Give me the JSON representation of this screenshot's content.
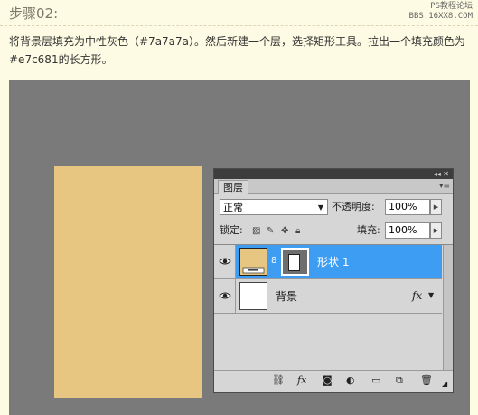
{
  "page": {
    "step_title": "步骤02:",
    "watermark_line1": "PS教程论坛",
    "watermark_line2": "BBS.16XX8.COM",
    "description": "将背景层填充为中性灰色（#7a7a7a）。然后新建一个层，选择矩形工具。拉出一个填充颜色为#e7c681的长方形。"
  },
  "colors": {
    "background_fill": "#7a7a7a",
    "rectangle_fill": "#e7c681",
    "selected_layer": "#3d9df3"
  },
  "layers_panel": {
    "titlebar_controls": "◂◂ ✕",
    "tab_label": "图层",
    "menu_icon": "panel-menu-icon",
    "blend_mode": "正常",
    "opacity_label": "不透明度:",
    "opacity_value": "100%",
    "lock_label": "锁定:",
    "fill_label": "填充:",
    "fill_value": "100%",
    "layers": [
      {
        "name": "形状 1",
        "selected": true,
        "visible": true
      },
      {
        "name": "背景",
        "selected": false,
        "visible": true,
        "fx": "fx"
      }
    ],
    "bottom_icons": [
      "link-icon",
      "fx-icon",
      "mask-icon",
      "adjustment-icon",
      "group-folder-icon",
      "new-layer-icon",
      "trash-icon"
    ],
    "fx_label": "fx"
  }
}
